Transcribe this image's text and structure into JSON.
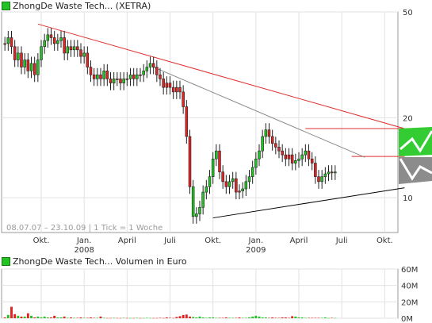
{
  "legend": {
    "price_label": "ZhongDe Waste Tech... (XETRA)",
    "volume_label": "ZhongDe Waste Tech... Volumen in Euro",
    "swatch_color": "#22c322"
  },
  "info_text": "08.07.07 – 23.10.09 | 1 Tick = 1 Woche",
  "colors": {
    "up": "#22c322",
    "down": "#e02424",
    "trend_red": "#e03030",
    "trend_gray": "#888888",
    "trend_black": "#000000",
    "projection_green": "#33cc33",
    "projection_gray": "#8c8c8c"
  },
  "chart_data": [
    {
      "type": "candlestick",
      "scale": "log",
      "ylim": [
        7.4,
        50
      ],
      "y_ticks": [
        {
          "value": 50,
          "label": "50"
        },
        {
          "value": 20,
          "label": "20"
        },
        {
          "value": 10,
          "label": "10"
        }
      ],
      "x_ticks": [
        {
          "week": 12,
          "label": "Okt.",
          "year": ""
        },
        {
          "week": 25,
          "label": "Jan.",
          "year": "2008"
        },
        {
          "week": 38,
          "label": "April",
          "year": ""
        },
        {
          "week": 51,
          "label": "Juli",
          "year": ""
        },
        {
          "week": 64,
          "label": "Okt.",
          "year": ""
        },
        {
          "week": 77,
          "label": "Jan.",
          "year": "2009"
        },
        {
          "week": 90,
          "label": "April",
          "year": ""
        },
        {
          "week": 103,
          "label": "Juli",
          "year": ""
        },
        {
          "week": 116,
          "label": "Okt.",
          "year": ""
        }
      ],
      "x_domain": [
        0,
        120
      ],
      "closes": [
        38,
        40,
        37,
        33,
        35,
        31,
        33,
        30,
        32,
        29,
        33,
        37,
        39,
        41,
        40,
        38,
        39,
        40,
        35,
        37,
        36,
        37,
        36,
        34,
        35,
        31,
        29,
        28,
        29,
        28,
        30,
        28,
        27,
        28,
        28,
        27,
        28,
        28,
        29,
        28,
        29,
        29,
        30,
        31,
        32,
        31,
        29,
        28,
        26,
        27,
        26,
        25,
        26,
        25,
        22,
        17,
        11,
        8.5,
        8.7,
        9.2,
        10.5,
        11,
        12,
        14,
        15,
        12.5,
        11.5,
        11,
        11.5,
        11.8,
        10.5,
        10.6,
        10.8,
        11.5,
        12,
        13,
        14,
        15,
        17,
        18,
        17,
        16,
        15.5,
        15,
        14.5,
        14,
        14.5,
        13.5,
        13.8,
        14,
        14.5,
        15,
        14,
        13.5,
        12,
        11.5,
        12,
        12.3,
        12.5,
        12.4,
        12.5
      ],
      "up_weeks": [
        1,
        4,
        6,
        8,
        10,
        11,
        12,
        13,
        16,
        17,
        19,
        21,
        24,
        28,
        30,
        33,
        36,
        38,
        40,
        42,
        43,
        44,
        57,
        58,
        59,
        60,
        61,
        62,
        63,
        64,
        68,
        69,
        72,
        73,
        74,
        75,
        76,
        77,
        78,
        79,
        88,
        89,
        90,
        91,
        96,
        97,
        98,
        100
      ],
      "trendlines": [
        {
          "name": "red-upper",
          "from": {
            "week": 11,
            "value": 45
          },
          "to": {
            "week": 122,
            "value": 18.2
          }
        },
        {
          "name": "red-horizontal",
          "from": {
            "week": 92,
            "value": 18.2
          },
          "to": {
            "week": 122,
            "value": 18.2
          }
        },
        {
          "name": "red-horizontal-2",
          "from": {
            "week": 106,
            "value": 14.3
          },
          "to": {
            "week": 122,
            "value": 14.3
          }
        },
        {
          "name": "gray-mid",
          "from": {
            "week": 46,
            "value": 31
          },
          "to": {
            "week": 110,
            "value": 14.2
          }
        },
        {
          "name": "black-support",
          "from": {
            "week": 64,
            "value": 8.4
          },
          "to": {
            "week": 122,
            "value": 10.9
          }
        }
      ]
    },
    {
      "type": "bar",
      "title": "ZhongDe Waste Tech... Volumen in Euro",
      "ylim": [
        0,
        60
      ],
      "y_ticks": [
        {
          "value": 60,
          "label": "60M"
        },
        {
          "value": 40,
          "label": "40M"
        },
        {
          "value": 20,
          "label": "20M"
        },
        {
          "value": 0,
          "label": "0M"
        }
      ],
      "values": [
        1,
        4,
        14,
        5,
        3,
        2,
        2,
        6,
        3,
        1,
        2,
        1,
        2,
        1,
        1,
        3,
        1,
        1,
        2,
        0.5,
        1,
        0.5,
        0.5,
        1,
        0.5,
        0.5,
        1,
        0.5,
        0.5,
        2,
        0.5,
        0.3,
        0.3,
        0.5,
        0.3,
        0.3,
        0.5,
        0.3,
        0.3,
        0.3,
        0.5,
        0.3,
        0.3,
        0.5,
        0.3,
        0.3,
        0.3,
        0.5,
        0.3,
        1,
        0.5,
        0.3,
        1.5,
        2.5,
        4,
        4.5,
        2,
        1.5,
        1,
        2,
        1,
        0.5,
        1,
        1,
        0.5,
        0.5,
        0.5,
        1,
        0.5,
        0.5,
        0.5,
        1,
        0.5,
        0.5,
        1,
        2,
        3,
        2,
        1,
        1,
        0.5,
        1,
        0.5,
        0.5,
        1,
        1,
        0.5,
        2.5,
        2,
        1,
        1,
        0.5,
        0.5,
        0.5,
        0.5,
        0.5,
        0.5,
        1,
        0.3,
        0.5,
        0.3
      ]
    }
  ]
}
